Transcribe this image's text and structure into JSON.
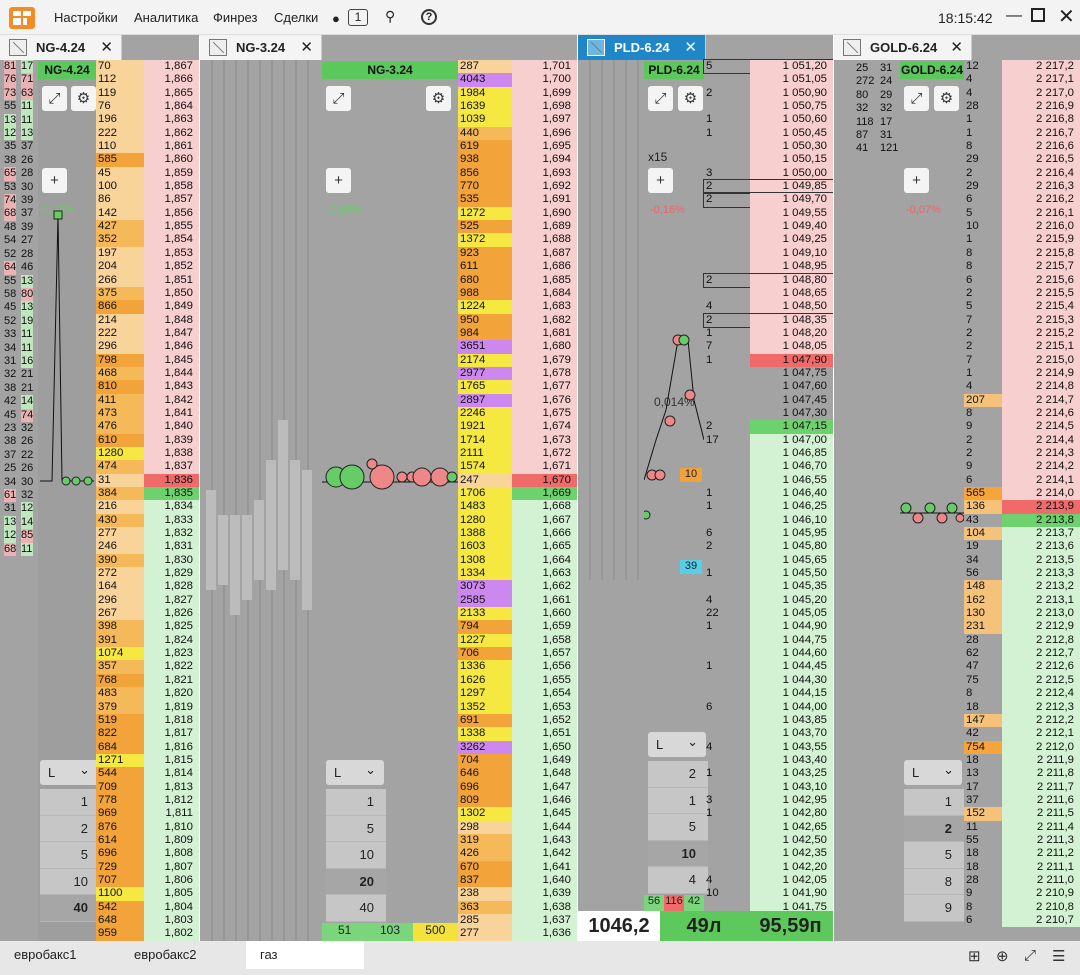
{
  "menu": {
    "settings": "Настройки",
    "analytics": "Аналитика",
    "finreg": "Финрез",
    "trades": "Сделки",
    "msg_count": "1",
    "clock": "18:15:42"
  },
  "panels": [
    {
      "tab": "NG-4.24",
      "head": "NG-4.24",
      "pct": "+0,11%",
      "left_cols": [
        [
          "81",
          "76",
          "73",
          "55",
          "13",
          "12",
          "35",
          "38",
          "65",
          "53",
          "74",
          "68",
          "48",
          "54",
          "52",
          "64",
          "55",
          "58",
          "45",
          "52",
          "33",
          "34",
          "31",
          "32",
          "38",
          "42",
          "45",
          "23",
          "38",
          "37",
          "25",
          "34",
          "61",
          "31",
          "13",
          "12",
          "68"
        ],
        [
          "17",
          "71",
          "63",
          "11",
          "11",
          "13",
          "37",
          "26",
          "28",
          "30",
          "39",
          "37",
          "39",
          "27",
          "28",
          "46",
          "13",
          "80",
          "13",
          "19",
          "11",
          "11",
          "16",
          "21",
          "21",
          "14",
          "74",
          "32",
          "26",
          "22",
          "26",
          "30",
          "32",
          "12",
          "14",
          "85",
          "11"
        ]
      ],
      "dom_rows": [
        [
          "70",
          "1,867"
        ],
        [
          "112",
          "1,866"
        ],
        [
          "119",
          "1,865"
        ],
        [
          "76",
          "1,864"
        ],
        [
          "196",
          "1,863"
        ],
        [
          "222",
          "1,862"
        ],
        [
          "110",
          "1,861"
        ],
        [
          "585",
          "1,860"
        ],
        [
          "45",
          "1,859"
        ],
        [
          "100",
          "1,858"
        ],
        [
          "86",
          "1,857"
        ],
        [
          "142",
          "1,856"
        ],
        [
          "427",
          "1,855"
        ],
        [
          "352",
          "1,854"
        ],
        [
          "197",
          "1,853"
        ],
        [
          "204",
          "1,852"
        ],
        [
          "266",
          "1,851"
        ],
        [
          "375",
          "1,850"
        ],
        [
          "866",
          "1,849"
        ],
        [
          "214",
          "1,848"
        ],
        [
          "222",
          "1,847"
        ],
        [
          "296",
          "1,846"
        ],
        [
          "798",
          "1,845"
        ],
        [
          "468",
          "1,844"
        ],
        [
          "810",
          "1,843"
        ],
        [
          "411",
          "1,842"
        ],
        [
          "473",
          "1,841"
        ],
        [
          "476",
          "1,840"
        ],
        [
          "610",
          "1,839"
        ],
        [
          "1280",
          "1,838"
        ],
        [
          "474",
          "1,837"
        ],
        [
          "31",
          "1,836"
        ],
        [
          "384",
          "1,835"
        ],
        [
          "216",
          "1,834"
        ],
        [
          "430",
          "1,833"
        ],
        [
          "277",
          "1,832"
        ],
        [
          "246",
          "1,831"
        ],
        [
          "390",
          "1,830"
        ],
        [
          "272",
          "1,829"
        ],
        [
          "164",
          "1,828"
        ],
        [
          "296",
          "1,827"
        ],
        [
          "267",
          "1,826"
        ],
        [
          "398",
          "1,825"
        ],
        [
          "391",
          "1,824"
        ],
        [
          "1074",
          "1,823"
        ],
        [
          "357",
          "1,822"
        ],
        [
          "768",
          "1,821"
        ],
        [
          "483",
          "1,820"
        ],
        [
          "379",
          "1,819"
        ],
        [
          "519",
          "1,818"
        ],
        [
          "822",
          "1,817"
        ],
        [
          "684",
          "1,816"
        ],
        [
          "1271",
          "1,815"
        ],
        [
          "544",
          "1,814"
        ],
        [
          "709",
          "1,813"
        ],
        [
          "778",
          "1,812"
        ],
        [
          "969",
          "1,811"
        ],
        [
          "876",
          "1,810"
        ],
        [
          "614",
          "1,809"
        ],
        [
          "696",
          "1,808"
        ],
        [
          "729",
          "1,807"
        ],
        [
          "707",
          "1,806"
        ],
        [
          "1100",
          "1,805"
        ],
        [
          "542",
          "1,804"
        ],
        [
          "648",
          "1,803"
        ],
        [
          "959",
          "1,802"
        ]
      ],
      "vols": [
        "1",
        "2",
        "5",
        "10",
        "40"
      ],
      "dd": "L"
    },
    {
      "tab": "NG-3.24",
      "head": "NG-3.24",
      "pct": "+0,06%",
      "dom_rows": [
        [
          "287",
          "1,701"
        ],
        [
          "4043",
          "1,700"
        ],
        [
          "1984",
          "1,699"
        ],
        [
          "1639",
          "1,698"
        ],
        [
          "1039",
          "1,697"
        ],
        [
          "440",
          "1,696"
        ],
        [
          "619",
          "1,695"
        ],
        [
          "938",
          "1,694"
        ],
        [
          "856",
          "1,693"
        ],
        [
          "770",
          "1,692"
        ],
        [
          "535",
          "1,691"
        ],
        [
          "1272",
          "1,690"
        ],
        [
          "525",
          "1,689"
        ],
        [
          "1372",
          "1,688"
        ],
        [
          "923",
          "1,687"
        ],
        [
          "611",
          "1,686"
        ],
        [
          "680",
          "1,685"
        ],
        [
          "988",
          "1,684"
        ],
        [
          "1224",
          "1,683"
        ],
        [
          "950",
          "1,682"
        ],
        [
          "984",
          "1,681"
        ],
        [
          "3651",
          "1,680"
        ],
        [
          "2174",
          "1,679"
        ],
        [
          "2977",
          "1,678"
        ],
        [
          "1765",
          "1,677"
        ],
        [
          "2897",
          "1,676"
        ],
        [
          "2246",
          "1,675"
        ],
        [
          "1921",
          "1,674"
        ],
        [
          "1714",
          "1,673"
        ],
        [
          "2111",
          "1,672"
        ],
        [
          "1574",
          "1,671"
        ],
        [
          "247",
          "1,670"
        ],
        [
          "1706",
          "1,669"
        ],
        [
          "1483",
          "1,668"
        ],
        [
          "1280",
          "1,667"
        ],
        [
          "1388",
          "1,666"
        ],
        [
          "1603",
          "1,665"
        ],
        [
          "1308",
          "1,664"
        ],
        [
          "1334",
          "1,663"
        ],
        [
          "3073",
          "1,662"
        ],
        [
          "2585",
          "1,661"
        ],
        [
          "2133",
          "1,660"
        ],
        [
          "794",
          "1,659"
        ],
        [
          "1227",
          "1,658"
        ],
        [
          "706",
          "1,657"
        ],
        [
          "1336",
          "1,656"
        ],
        [
          "1626",
          "1,655"
        ],
        [
          "1297",
          "1,654"
        ],
        [
          "1352",
          "1,653"
        ],
        [
          "691",
          "1,652"
        ],
        [
          "1338",
          "1,651"
        ],
        [
          "3262",
          "1,650"
        ],
        [
          "704",
          "1,649"
        ],
        [
          "646",
          "1,648"
        ],
        [
          "696",
          "1,647"
        ],
        [
          "809",
          "1,646"
        ],
        [
          "1302",
          "1,645"
        ],
        [
          "298",
          "1,644"
        ],
        [
          "319",
          "1,643"
        ],
        [
          "426",
          "1,642"
        ],
        [
          "670",
          "1,641"
        ],
        [
          "837",
          "1,640"
        ],
        [
          "238",
          "1,639"
        ],
        [
          "363",
          "1,638"
        ],
        [
          "285",
          "1,637"
        ],
        [
          "277",
          "1,636"
        ]
      ],
      "vols": [
        "1",
        "5",
        "10",
        "20",
        "40"
      ],
      "dd": "L",
      "bottom": [
        "51",
        "103",
        "500"
      ]
    },
    {
      "tab": "PLD-6.24",
      "head": "PLD-6.24",
      "pct": "-0,16%",
      "mult": "x15",
      "pct2": "0,014%",
      "dom_rows": [
        [
          "5",
          "1 051,20"
        ],
        [
          "",
          "1 051,05"
        ],
        [
          "2",
          "1 050,90"
        ],
        [
          "",
          "1 050,75"
        ],
        [
          "1",
          "1 050,60"
        ],
        [
          "1",
          "1 050,45"
        ],
        [
          "",
          "1 050,30"
        ],
        [
          "",
          "1 050,15"
        ],
        [
          "3",
          "1 050,00"
        ],
        [
          "2",
          "1 049,85"
        ],
        [
          "2",
          "1 049,70"
        ],
        [
          "",
          "1 049,55"
        ],
        [
          "",
          "1 049,40"
        ],
        [
          "",
          "1 049,25"
        ],
        [
          "",
          "1 049,10"
        ],
        [
          "",
          "1 048,95"
        ],
        [
          "2",
          "1 048,80"
        ],
        [
          "",
          "1 048,65"
        ],
        [
          "4",
          "1 048,50"
        ],
        [
          "2",
          "1 048,35"
        ],
        [
          "1",
          "1 048,20"
        ],
        [
          "7",
          "1 048,05"
        ],
        [
          "1",
          "1 047,90"
        ],
        [
          "",
          "1 047,75"
        ],
        [
          "",
          "1 047,60"
        ],
        [
          "",
          "1 047,45"
        ],
        [
          "",
          "1 047,30"
        ],
        [
          "2",
          "1 047,15"
        ],
        [
          "17",
          "1 047,00"
        ],
        [
          "",
          "1 046,85"
        ],
        [
          "",
          "1 046,70"
        ],
        [
          "",
          "1 046,55"
        ],
        [
          "1",
          "1 046,40"
        ],
        [
          "1",
          "1 046,25"
        ],
        [
          "",
          "1 046,10"
        ],
        [
          "6",
          "1 045,95"
        ],
        [
          "2",
          "1 045,80"
        ],
        [
          "",
          "1 045,65"
        ],
        [
          "1",
          "1 045,50"
        ],
        [
          "",
          "1 045,35"
        ],
        [
          "4",
          "1 045,20"
        ],
        [
          "22",
          "1 045,05"
        ],
        [
          "1",
          "1 044,90"
        ],
        [
          "",
          "1 044,75"
        ],
        [
          "",
          "1 044,60"
        ],
        [
          "1",
          "1 044,45"
        ],
        [
          "",
          "1 044,30"
        ],
        [
          "",
          "1 044,15"
        ],
        [
          "6",
          "1 044,00"
        ],
        [
          "",
          "1 043,85"
        ],
        [
          "",
          "1 043,70"
        ],
        [
          "4",
          "1 043,55"
        ],
        [
          "",
          "1 043,40"
        ],
        [
          "1",
          "1 043,25"
        ],
        [
          "",
          "1 043,10"
        ],
        [
          "3",
          "1 042,95"
        ],
        [
          "1",
          "1 042,80"
        ],
        [
          "",
          "1 042,65"
        ],
        [
          "",
          "1 042,50"
        ],
        [
          "",
          "1 042,35"
        ],
        [
          "",
          "1 042,20"
        ],
        [
          "4",
          "1 042,05"
        ],
        [
          "10",
          "1 041,90"
        ],
        [
          "",
          "1 041,75"
        ]
      ],
      "orders": [
        "5 X",
        "2 X",
        "2 X",
        "2 X",
        "2 X"
      ],
      "vols": [
        "2",
        "1",
        "5",
        "10",
        "4"
      ],
      "dd": "L",
      "price": "1046,2",
      "lots": "49л",
      "pts": "95,59п",
      "left_sums": [
        "56",
        "116",
        "42"
      ],
      "tag10": "10",
      "tag39": "39"
    },
    {
      "tab": "GOLD-6.24",
      "head": "GOLD-6.24",
      "pct": "-0,07%",
      "left_cols": [
        [
          "25",
          "272",
          "80",
          "32",
          "118",
          "87",
          "41"
        ],
        [
          "31",
          "24",
          "29",
          "32",
          "17",
          "31",
          "121"
        ]
      ],
      "dom_rows": [
        [
          "12",
          "2 217,2"
        ],
        [
          "4",
          "2 217,1"
        ],
        [
          "4",
          "2 217,0"
        ],
        [
          "28",
          "2 216,9"
        ],
        [
          "1",
          "2 216,8"
        ],
        [
          "1",
          "2 216,7"
        ],
        [
          "8",
          "2 216,6"
        ],
        [
          "29",
          "2 216,5"
        ],
        [
          "2",
          "2 216,4"
        ],
        [
          "29",
          "2 216,3"
        ],
        [
          "6",
          "2 216,2"
        ],
        [
          "5",
          "2 216,1"
        ],
        [
          "10",
          "2 216,0"
        ],
        [
          "1",
          "2 215,9"
        ],
        [
          "8",
          "2 215,8"
        ],
        [
          "8",
          "2 215,7"
        ],
        [
          "6",
          "2 215,6"
        ],
        [
          "2",
          "2 215,5"
        ],
        [
          "5",
          "2 215,4"
        ],
        [
          "7",
          "2 215,3"
        ],
        [
          "2",
          "2 215,2"
        ],
        [
          "2",
          "2 215,1"
        ],
        [
          "7",
          "2 215,0"
        ],
        [
          "1",
          "2 214,9"
        ],
        [
          "4",
          "2 214,8"
        ],
        [
          "207",
          "2 214,7"
        ],
        [
          "8",
          "2 214,6"
        ],
        [
          "9",
          "2 214,5"
        ],
        [
          "2",
          "2 214,4"
        ],
        [
          "2",
          "2 214,3"
        ],
        [
          "9",
          "2 214,2"
        ],
        [
          "6",
          "2 214,1"
        ],
        [
          "565",
          "2 214,0"
        ],
        [
          "136",
          "2 213,9"
        ],
        [
          "43",
          "2 213,8"
        ],
        [
          "104",
          "2 213,7"
        ],
        [
          "19",
          "2 213,6"
        ],
        [
          "34",
          "2 213,5"
        ],
        [
          "56",
          "2 213,3"
        ],
        [
          "148",
          "2 213,2"
        ],
        [
          "162",
          "2 213,1"
        ],
        [
          "130",
          "2 213,0"
        ],
        [
          "231",
          "2 212,9"
        ],
        [
          "28",
          "2 212,8"
        ],
        [
          "62",
          "2 212,7"
        ],
        [
          "47",
          "2 212,6"
        ],
        [
          "75",
          "2 212,5"
        ],
        [
          "8",
          "2 212,4"
        ],
        [
          "18",
          "2 212,3"
        ],
        [
          "147",
          "2 212,2"
        ],
        [
          "42",
          "2 212,1"
        ],
        [
          "754",
          "2 212,0"
        ],
        [
          "18",
          "2 211,9"
        ],
        [
          "13",
          "2 211,8"
        ],
        [
          "17",
          "2 211,7"
        ],
        [
          "37",
          "2 211,6"
        ],
        [
          "152",
          "2 211,5"
        ],
        [
          "11",
          "2 211,4"
        ],
        [
          "55",
          "2 211,3"
        ],
        [
          "18",
          "2 211,2"
        ],
        [
          "18",
          "2 211,1"
        ],
        [
          "28",
          "2 211,0"
        ],
        [
          "9",
          "2 210,9"
        ],
        [
          "8",
          "2 210,8"
        ],
        [
          "6",
          "2 210,7"
        ]
      ],
      "vols": [
        "1",
        "2",
        "5",
        "8",
        "9"
      ],
      "dd": "L"
    }
  ],
  "bottom_tabs": [
    "евробакс1",
    "евробакс2",
    "газ"
  ]
}
